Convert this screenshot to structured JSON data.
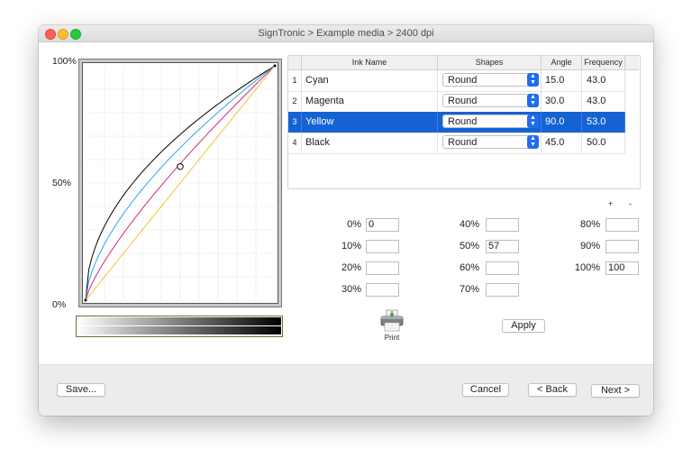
{
  "window": {
    "title": "SignTronic > Example media > 2400 dpi"
  },
  "curve": {
    "y_labels": {
      "top": "100%",
      "mid": "50%",
      "bottom": "0%"
    },
    "colors": {
      "black": "#000000",
      "cyan": "#2aa7e8",
      "magenta": "#d5267e",
      "yellow": "#f3c33a"
    },
    "point_value": {
      "x": 50,
      "y": 57
    }
  },
  "table": {
    "headers": {
      "ink": "Ink Name",
      "shapes": "Shapes",
      "angle": "Angle",
      "frequency": "Frequency"
    },
    "rows": [
      {
        "num": "1",
        "ink": "Cyan",
        "shape": "Round",
        "angle": "15.0",
        "frequency": "43.0",
        "selected": false
      },
      {
        "num": "2",
        "ink": "Magenta",
        "shape": "Round",
        "angle": "30.0",
        "frequency": "43.0",
        "selected": false
      },
      {
        "num": "3",
        "ink": "Yellow",
        "shape": "Round",
        "angle": "90.0",
        "frequency": "53.0",
        "selected": true
      },
      {
        "num": "4",
        "ink": "Black",
        "shape": "Round",
        "angle": "45.0",
        "frequency": "50.0",
        "selected": false
      }
    ],
    "plus": "+",
    "minus": "-",
    "selection_color": "#1563d2"
  },
  "percent_fields": [
    {
      "label": "0%",
      "value": "0"
    },
    {
      "label": "10%",
      "value": ""
    },
    {
      "label": "20%",
      "value": ""
    },
    {
      "label": "30%",
      "value": ""
    },
    {
      "label": "40%",
      "value": ""
    },
    {
      "label": "50%",
      "value": "57"
    },
    {
      "label": "60%",
      "value": ""
    },
    {
      "label": "70%",
      "value": ""
    },
    {
      "label": "80%",
      "value": ""
    },
    {
      "label": "90%",
      "value": ""
    },
    {
      "label": "100%",
      "value": "100"
    }
  ],
  "actions": {
    "print": "Print",
    "apply": "Apply",
    "save": "Save...",
    "cancel": "Cancel",
    "back": "< Back",
    "next": "Next >"
  }
}
